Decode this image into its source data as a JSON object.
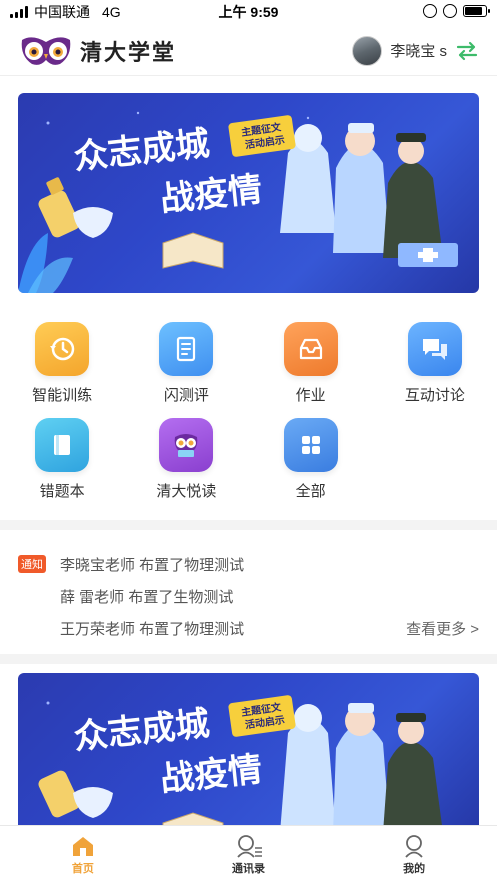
{
  "status_bar": {
    "carrier": "中国联通",
    "network": "4G",
    "time": "上午 9:59"
  },
  "header": {
    "app_name": "清大学堂",
    "user_name": "李晓宝 s"
  },
  "banner": {
    "headline_line1": "众志成城",
    "headline_line2": "战疫情",
    "tag_line1": "主题征文",
    "tag_line2": "活动启示"
  },
  "grid": {
    "items": [
      {
        "label": "智能训练",
        "icon": "history-icon",
        "color": "#f6b13d"
      },
      {
        "label": "闪测评",
        "icon": "document-icon",
        "color": "#55a6f2"
      },
      {
        "label": "作业",
        "icon": "inbox-icon",
        "color": "#f0873a"
      },
      {
        "label": "互动讨论",
        "icon": "chat-icon",
        "color": "#4a9ef3"
      },
      {
        "label": "错题本",
        "icon": "book-icon",
        "color": "#3fb1e6"
      },
      {
        "label": "清大悦读",
        "icon": "owl-icon",
        "color": "#9b52d8"
      },
      {
        "label": "全部",
        "icon": "apps-icon",
        "color": "#4d8fe8"
      }
    ]
  },
  "notices": {
    "badge": "通知",
    "items": [
      "李晓宝老师 布置了物理测试",
      "薛  雷老师 布置了生物测试",
      "王万荣老师 布置了物理测试"
    ],
    "more": "查看更多 >"
  },
  "tabbar": {
    "tabs": [
      {
        "label": "首页",
        "icon": "home-icon",
        "active": true
      },
      {
        "label": "通讯录",
        "icon": "contacts-icon",
        "active": false
      },
      {
        "label": "我的",
        "icon": "profile-icon",
        "active": false
      }
    ],
    "active_color": "#f0a33a"
  }
}
